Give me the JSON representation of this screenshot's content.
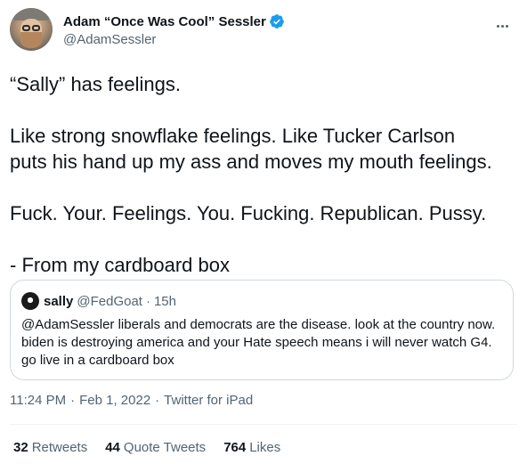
{
  "author": {
    "display_name": "Adam “Once Was Cool” Sessler",
    "handle": "@AdamSessler",
    "verified": true
  },
  "tweet": {
    "lines": [
      "“Sally” has feelings.",
      "",
      "Like strong snowflake feelings. Like Tucker Carlson",
      "puts his hand up my ass and moves my mouth feelings.",
      "",
      "Fuck. Your. Feelings. You. Fucking. Republican. Pussy.",
      "",
      "- From my cardboard box"
    ]
  },
  "quote": {
    "name": "sally",
    "handle": "@FedGoat",
    "separator": "·",
    "time": "15h",
    "lines": [
      "@AdamSessler  liberals and democrats are the disease. look at the country now.",
      "biden is destroying america and your Hate speech means i will never watch G4.",
      "go live in a cardboard box"
    ]
  },
  "meta": {
    "time": "11:24 PM",
    "date": "Feb 1, 2022",
    "source": "Twitter for iPad",
    "separator": "·"
  },
  "stats": [
    {
      "count": "32",
      "label": "Retweets"
    },
    {
      "count": "44",
      "label": "Quote Tweets"
    },
    {
      "count": "764",
      "label": "Likes"
    }
  ],
  "icons": {
    "verified": "verified-badge-icon",
    "more": "more-options-icon"
  },
  "colors": {
    "verified_blue": "#1d9bf0",
    "secondary_text": "#536471",
    "border": "#cfd9de"
  }
}
